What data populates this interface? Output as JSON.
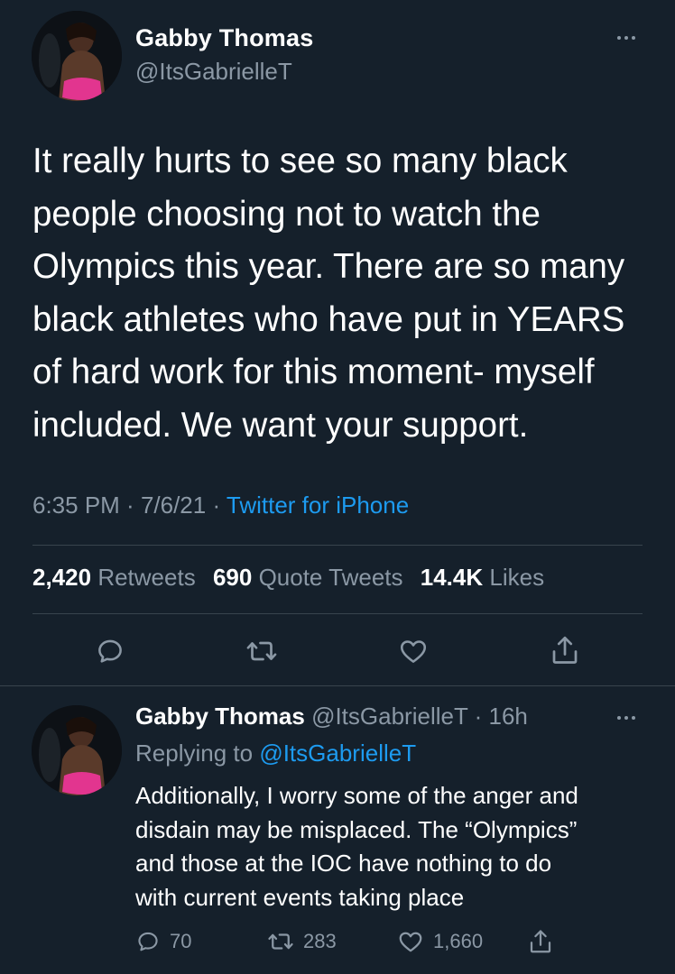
{
  "tweet": {
    "author_name": "Gabby Thomas",
    "author_handle": "@ItsGabrielleT",
    "text": "It really hurts to see so many black\npeople choosing not to watch the\nOlympics this year. There are so many\nblack athletes who have put in YEARS\nof hard work for this moment- myself\nincluded. We want your support.",
    "time": "6:35 PM",
    "date": "7/6/21",
    "separator": " · ",
    "source": "Twitter for iPhone",
    "stats": {
      "retweets_count": "2,420",
      "retweets_label": "Retweets",
      "quotes_count": "690",
      "quotes_label": "Quote Tweets",
      "likes_count": "14.4K",
      "likes_label": "Likes"
    },
    "actions": [
      "reply-icon",
      "retweet-icon",
      "like-icon",
      "share-icon"
    ]
  },
  "reply": {
    "author_name": "Gabby Thomas",
    "author_handle": "@ItsGabrielleT",
    "age": "16h",
    "separator": " · ",
    "replying_prefix": "Replying to",
    "replying_to": "@ItsGabrielleT",
    "text": "Additionally, I worry some of the anger and\ndisdain may be misplaced. The “Olympics”\nand those at the IOC have nothing to do\nwith current events taking place",
    "reply_count": "70",
    "retweet_count": "283",
    "like_count": "1,660"
  },
  "colors": {
    "background": "#15202b",
    "secondary_text": "#8b98a5",
    "link": "#1d9bf0",
    "divider": "#38444d"
  }
}
